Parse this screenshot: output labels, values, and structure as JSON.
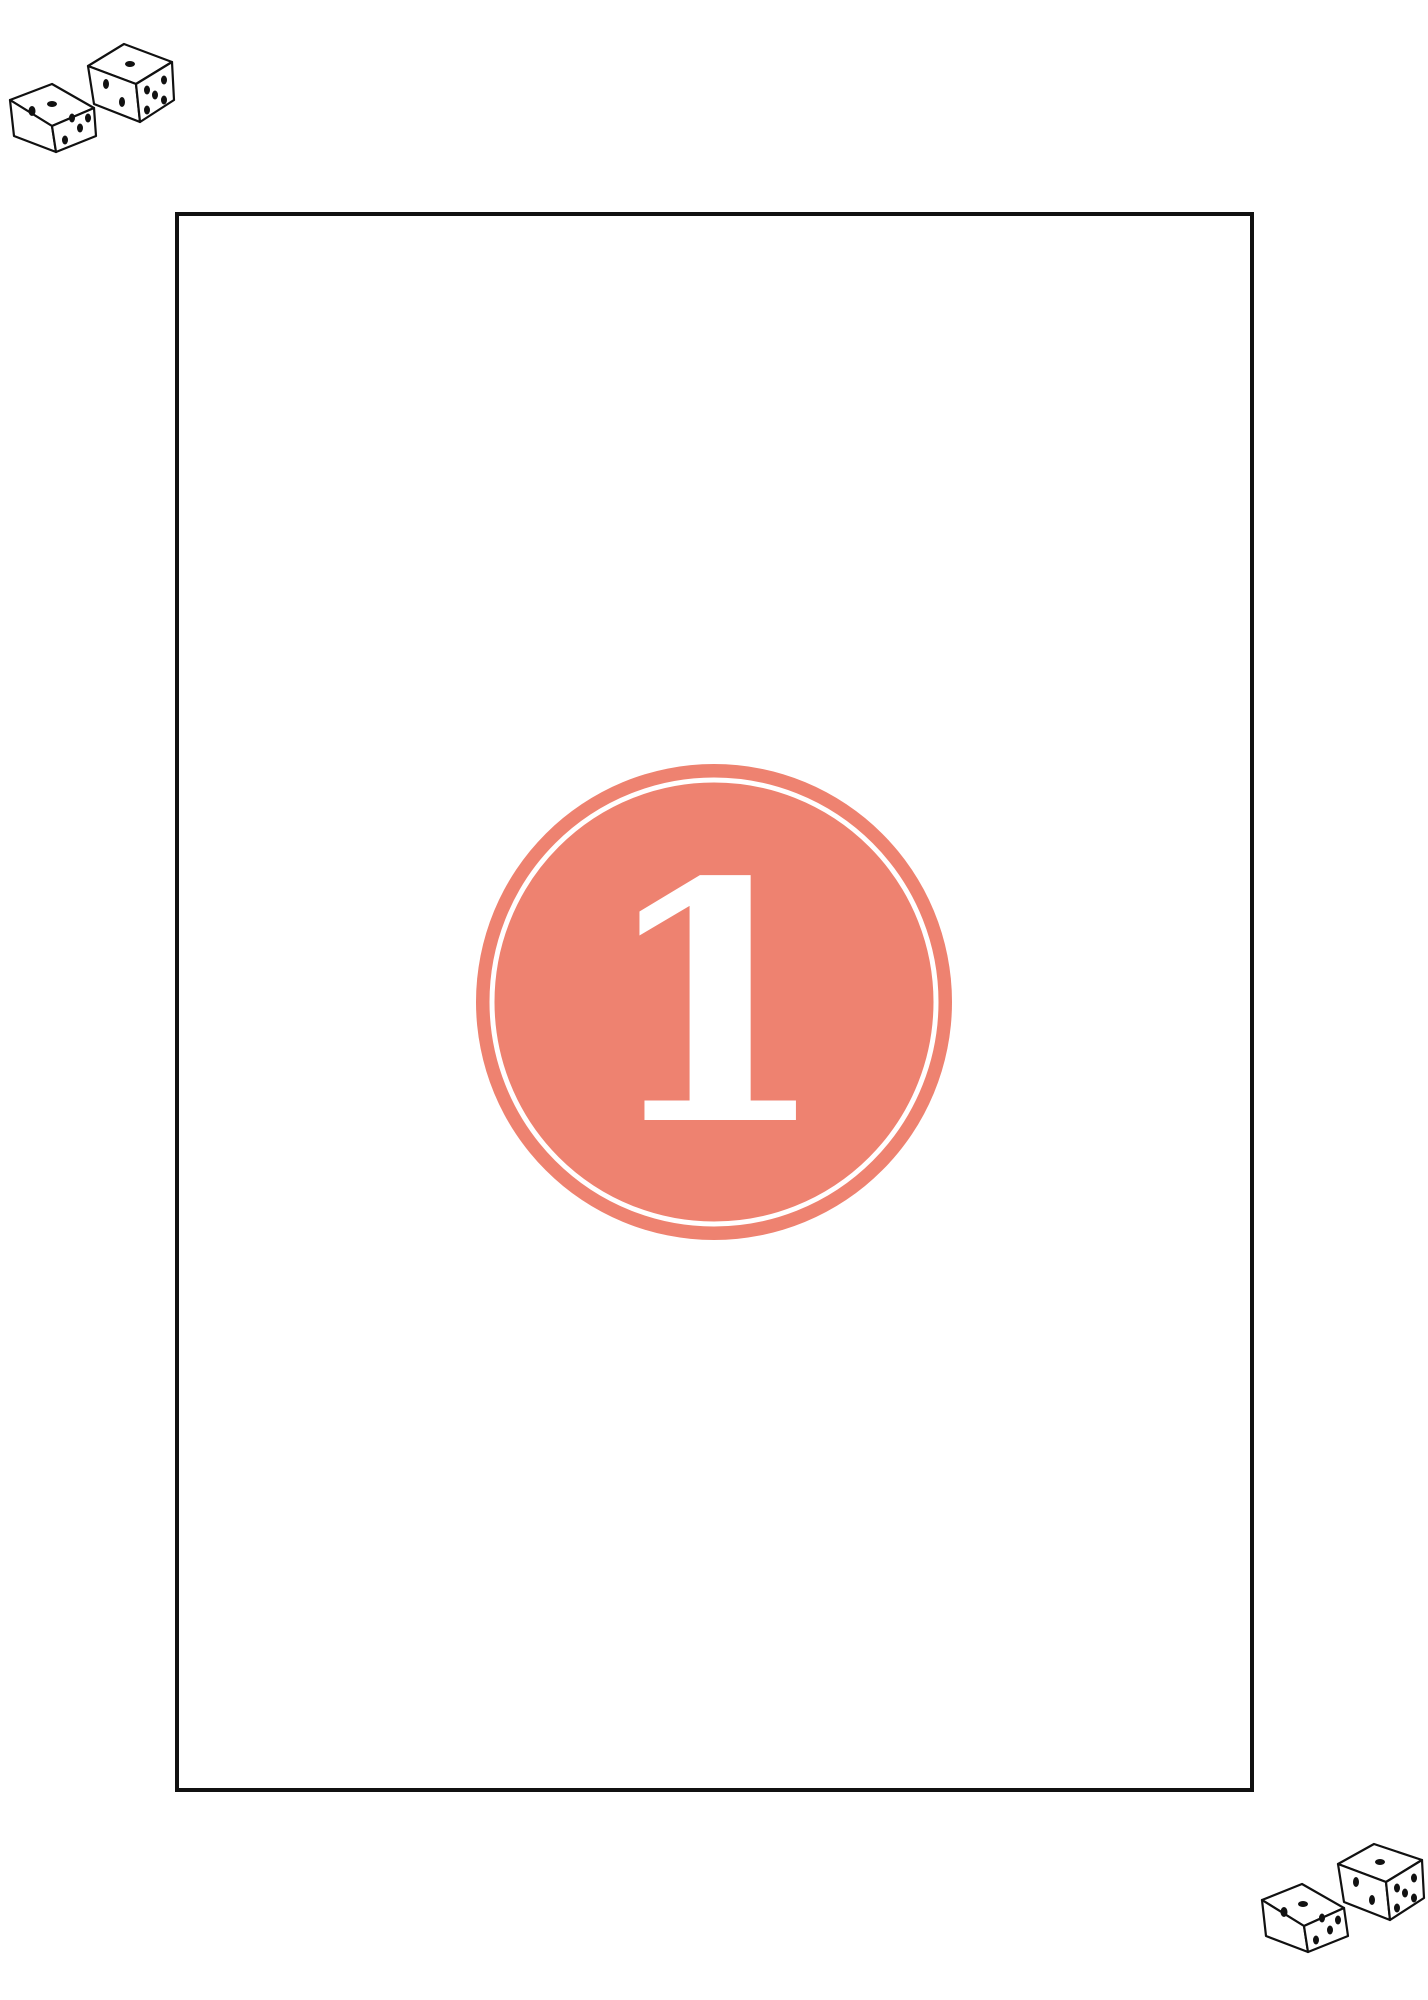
{
  "card": {
    "number": "1"
  },
  "colors": {
    "badge": "#EE8270",
    "badge_ring": "#ffffff",
    "frame": "#111111",
    "background": "#ffffff",
    "dice_outline": "#111111",
    "dice_pips": "#111111"
  },
  "decorations": {
    "top_left": "dice-pair-icon",
    "bottom_right": "dice-pair-icon"
  }
}
